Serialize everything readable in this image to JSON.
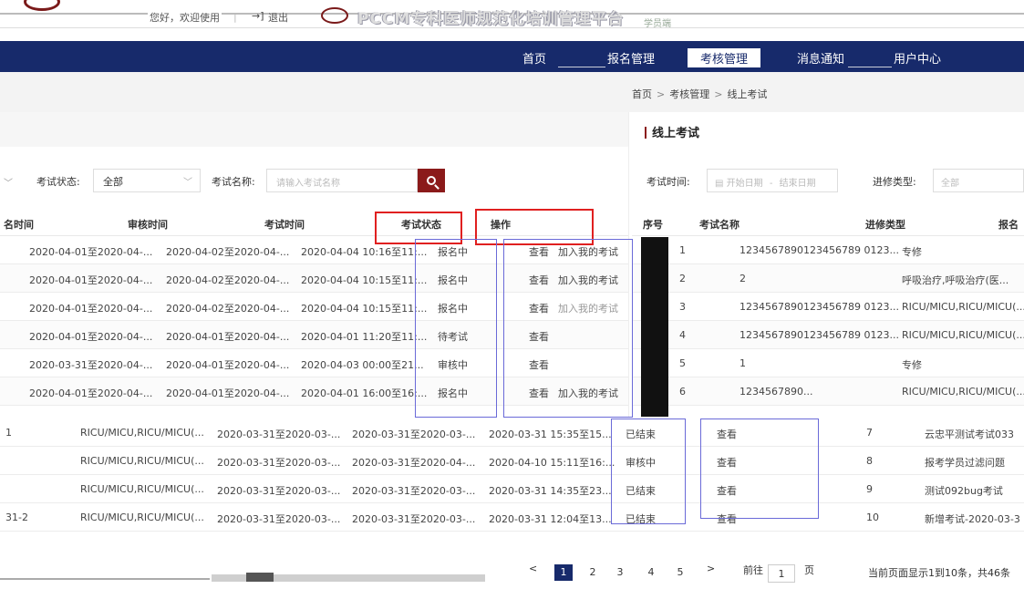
{
  "header": {
    "greeting": "您好，欢迎使用",
    "separator": "|",
    "logout_label": "退出",
    "brand_title": "PCCM专科医师规范化培训管理平台",
    "brand_sub": "学员端"
  },
  "nav": {
    "items": [
      "首页",
      "报名管理",
      "考核管理",
      "消息通知",
      "用户中心"
    ],
    "active": "考核管理"
  },
  "breadcrumb": {
    "home": "首页",
    "mid": "考核管理",
    "current": "线上考试",
    "sep": ">"
  },
  "section_title": "线上考试",
  "filters_left": {
    "status_label": "考试状态:",
    "status_value": "全部",
    "name_label": "考试名称:",
    "name_placeholder": "请输入考试名称"
  },
  "filters_right": {
    "time_label": "考试时间:",
    "start_placeholder": "开始日期",
    "range_sep": "-",
    "end_placeholder": "结束日期",
    "type_label": "进修类型:",
    "type_value": "全部"
  },
  "left_headers": [
    "名时间",
    "审核时间",
    "考试时间",
    "考试状态",
    "操作"
  ],
  "right_headers": [
    "序号",
    "考试名称",
    "进修类型",
    "报名"
  ],
  "left_rows": [
    {
      "c1": "2020-04-01至2020-04-...",
      "c2": "2020-04-02至2020-04-...",
      "c3": "2020-04-04 10:16至11:...",
      "status": "报名中",
      "ops": [
        "查看",
        "加入我的考试"
      ]
    },
    {
      "c1": "2020-04-01至2020-04-...",
      "c2": "2020-04-02至2020-04-...",
      "c3": "2020-04-04 10:15至11:...",
      "status": "报名中",
      "ops": [
        "查看",
        "加入我的考试"
      ]
    },
    {
      "c1": "2020-04-01至2020-04-...",
      "c2": "2020-04-02至2020-04-...",
      "c3": "2020-04-04 10:15至11:...",
      "status": "报名中",
      "ops": [
        "查看",
        "加入我的考试"
      ]
    },
    {
      "c1": "2020-04-01至2020-04-...",
      "c2": "2020-04-01至2020-04-...",
      "c3": "2020-04-01 11:20至11:...",
      "status": "待考试",
      "ops": [
        "查看",
        ""
      ]
    },
    {
      "c1": "2020-03-31至2020-04-...",
      "c2": "2020-04-01至2020-04-...",
      "c3": "2020-04-03 00:00至21...",
      "status": "审核中",
      "ops": [
        "查看",
        ""
      ]
    },
    {
      "c1": "2020-04-01至2020-04-...",
      "c2": "2020-04-01至2020-04-...",
      "c3": "2020-04-01 16:00至16:...",
      "status": "报名中",
      "ops": [
        "查看",
        "加入我的考试"
      ]
    }
  ],
  "right_rows": [
    {
      "no": "1",
      "name": "1234567890123456789 0123...",
      "type": "专修"
    },
    {
      "no": "2",
      "name": "2",
      "type": "呼吸治疗,呼吸治疗(医..."
    },
    {
      "no": "3",
      "name": "1234567890123456789 0123...",
      "type": "RICU/MICU,RICU/MICU(..."
    },
    {
      "no": "4",
      "name": "1234567890123456789 0123...",
      "type": "RICU/MICU,RICU/MICU(..."
    },
    {
      "no": "5",
      "name": "1",
      "type": "专修"
    },
    {
      "no": "6",
      "name": "1234567890...",
      "type": "RICU/MICU,RICU/MICU(..."
    }
  ],
  "lower_rows": [
    {
      "lead": "1",
      "type": "RICU/MICU,RICU/MICU(...",
      "d1": "2020-03-31至2020-03-...",
      "d2": "2020-03-31至2020-03-...",
      "d3": "2020-03-31 15:35至15...",
      "status": "已结束",
      "op": "查看",
      "no": "7",
      "name": "云忠平测试考试033"
    },
    {
      "lead": "",
      "type": "RICU/MICU,RICU/MICU(...",
      "d1": "2020-03-31至2020-03-...",
      "d2": "2020-03-31至2020-04-...",
      "d3": "2020-04-10 15:11至16:...",
      "status": "审核中",
      "op": "查看",
      "no": "8",
      "name": "报考学员过滤问题"
    },
    {
      "lead": "",
      "type": "RICU/MICU,RICU/MICU(...",
      "d1": "2020-03-31至2020-03-...",
      "d2": "2020-03-31至2020-03-...",
      "d3": "2020-03-31 14:35至23...",
      "status": "已结束",
      "op": "查看",
      "no": "9",
      "name": "测试092bug考试"
    },
    {
      "lead": "31-2",
      "type": "RICU/MICU,RICU/MICU(...",
      "d1": "2020-03-31至2020-03-...",
      "d2": "2020-03-31至2020-03-...",
      "d3": "2020-03-31 12:04至13...",
      "status": "已结束",
      "op": "查看",
      "no": "10",
      "name": "新增考试-2020-03-3"
    }
  ],
  "pagination": {
    "pages": [
      "1",
      "2",
      "3",
      "4",
      "5"
    ],
    "active_page": "1",
    "prev": "<",
    "next": ">",
    "goto_label": "前往",
    "goto_value": "1",
    "page_unit": "页",
    "summary": "当前页面显示1到10条，共46条"
  },
  "colors": {
    "nav_bg": "#172a6b",
    "brand_red": "#8b1a1a",
    "highlight_red": "#e02020",
    "overlay_blue": "#6a6ad8"
  },
  "icons": {
    "search": "search-icon",
    "calendar": "calendar-icon",
    "logout": "logout-icon",
    "logo": "university-seal-icon"
  }
}
